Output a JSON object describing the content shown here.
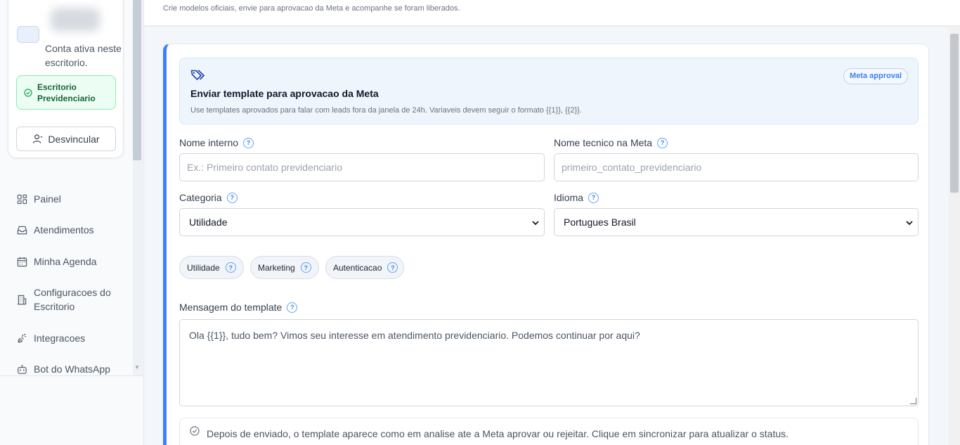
{
  "header": {
    "subtitle": "Crie modelos oficiais, envie para aprovacao da Meta e acompanhe se foram liberados."
  },
  "sidebar": {
    "account_text": "Conta ativa neste escritorio.",
    "office_badge": "Escritorio Previdenciario",
    "unlink_label": "Desvincular",
    "items": [
      {
        "label": "Painel",
        "icon": "grid-icon"
      },
      {
        "label": "Atendimentos",
        "icon": "inbox-icon"
      },
      {
        "label": "Minha Agenda",
        "icon": "calendar-icon"
      },
      {
        "label": "Configuracoes do Escritorio",
        "icon": "building-icon"
      },
      {
        "label": "Integracoes",
        "icon": "plug-icon"
      },
      {
        "label": "Bot do WhatsApp",
        "icon": "bot-icon"
      }
    ]
  },
  "info": {
    "title": "Enviar template para aprovacao da Meta",
    "description": "Use templates aprovados para falar com leads fora da janela de 24h. Variaveis devem seguir o formato {{1}}, {{2}}.",
    "pill": "Meta approval"
  },
  "form": {
    "internal_name": {
      "label": "Nome interno",
      "placeholder": "Ex.: Primeiro contato previdenciario"
    },
    "meta_name": {
      "label": "Nome tecnico na Meta",
      "placeholder": "primeiro_contato_previdenciario"
    },
    "category": {
      "label": "Categoria",
      "value": "Utilidade"
    },
    "language": {
      "label": "Idioma",
      "value": "Portugues Brasil"
    },
    "category_chips": [
      "Utilidade",
      "Marketing",
      "Autenticacao"
    ],
    "message": {
      "label": "Mensagem do template",
      "value": "Ola {{1}}, tudo bem? Vimos seu interesse em atendimento previdenciario. Podemos continuar por aqui?"
    },
    "notice": "Depois de enviado, o template aparece como em analise ate a Meta aprovar ou rejeitar. Clique em sincronizar para atualizar o status."
  },
  "colors": {
    "accent": "#3b82f6",
    "success": "#16a34a",
    "info_bg": "#eef5fd"
  }
}
